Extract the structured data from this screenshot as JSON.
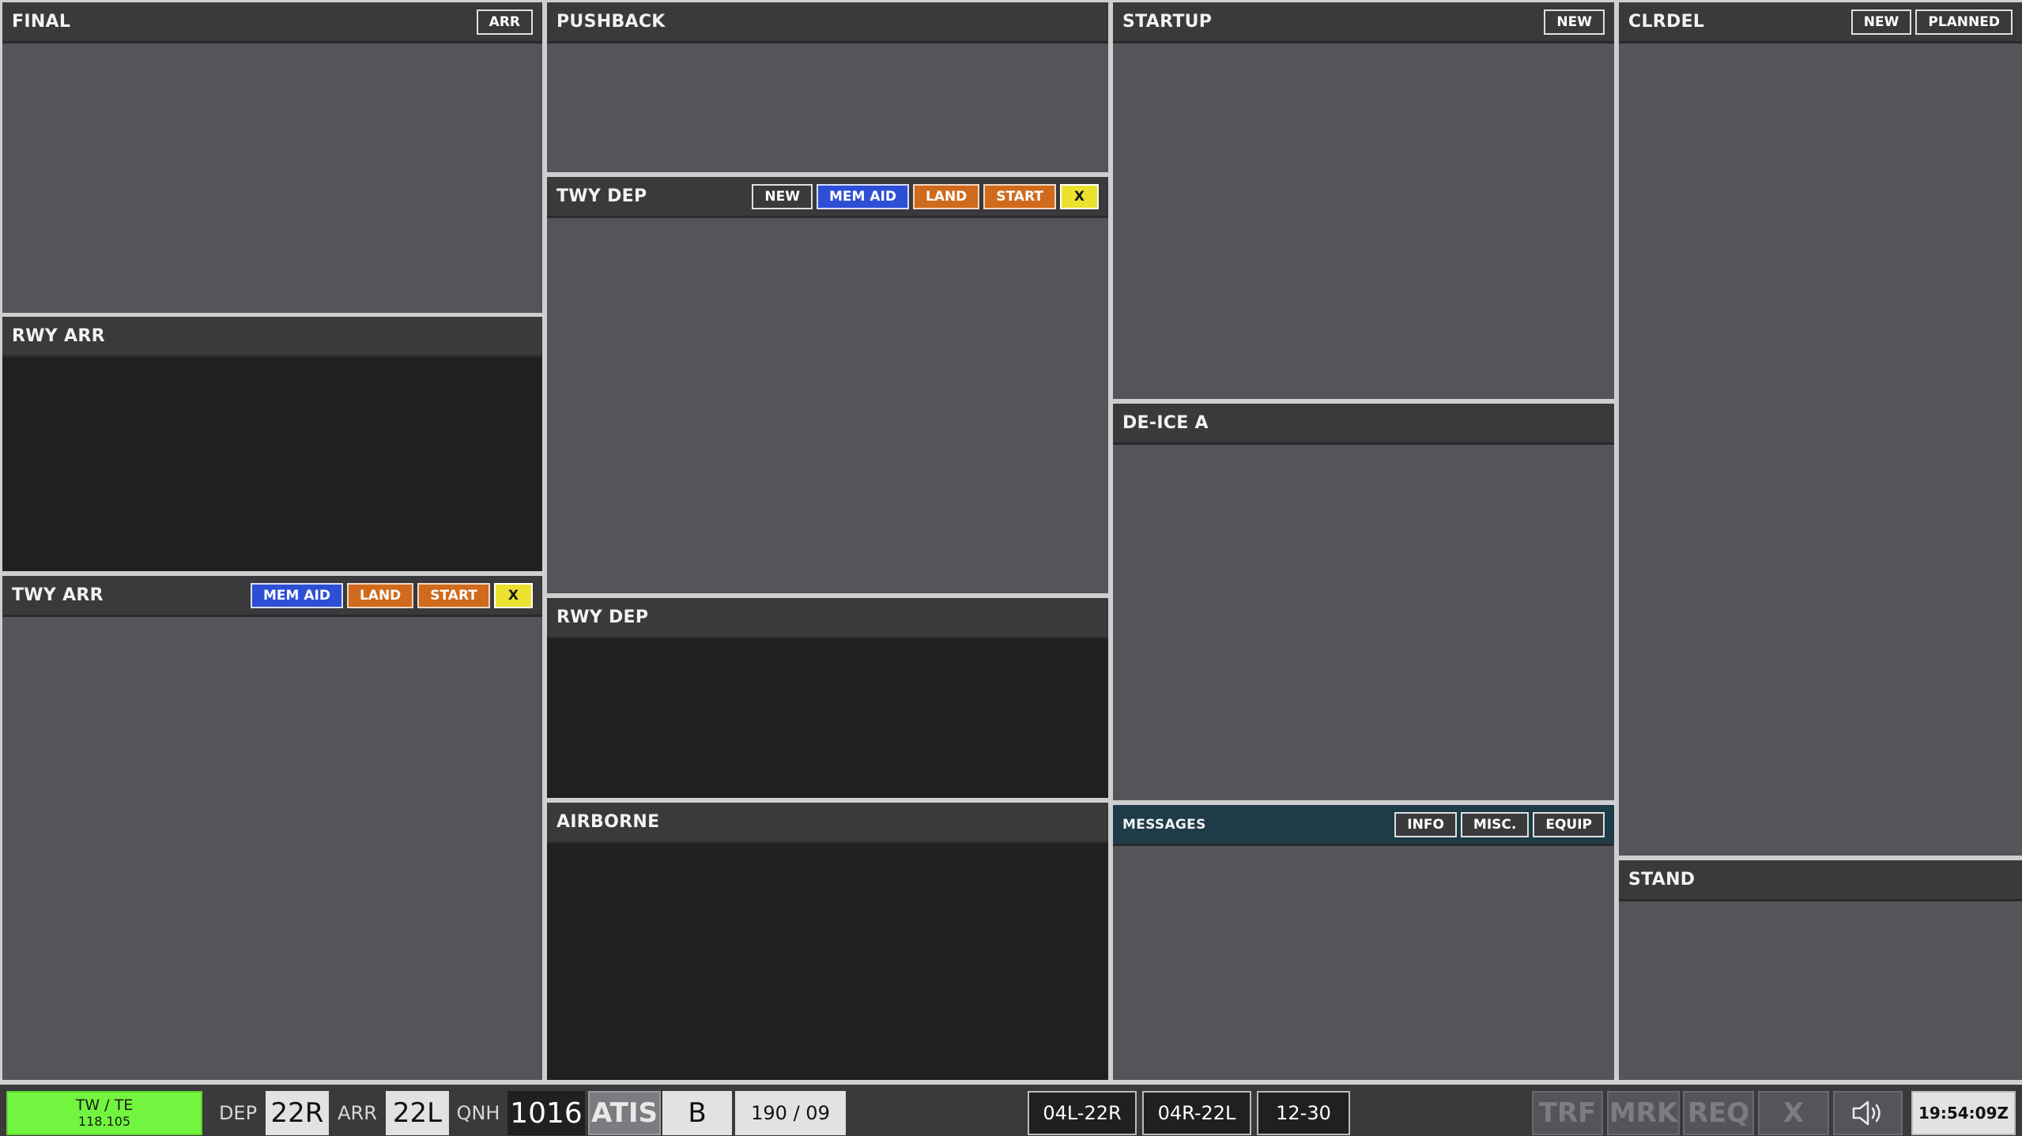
{
  "panels": {
    "final": {
      "title": "FINAL",
      "buttons": [
        "ARR"
      ]
    },
    "rwy_arr": {
      "title": "RWY ARR"
    },
    "twy_arr": {
      "title": "TWY ARR",
      "buttons": [
        "MEM AID",
        "LAND",
        "START",
        "X"
      ]
    },
    "pushback": {
      "title": "PUSHBACK"
    },
    "twy_dep": {
      "title": "TWY DEP",
      "buttons": [
        "NEW",
        "MEM AID",
        "LAND",
        "START",
        "X"
      ]
    },
    "rwy_dep": {
      "title": "RWY DEP"
    },
    "airborne": {
      "title": "AIRBORNE"
    },
    "startup": {
      "title": "STARTUP",
      "buttons": [
        "NEW"
      ]
    },
    "deice": {
      "title": "DE-ICE A"
    },
    "messages": {
      "title": "MESSAGES",
      "buttons": [
        "INFO",
        "MISC.",
        "EQUIP"
      ]
    },
    "clrdel": {
      "title": "CLRDEL",
      "buttons": [
        "NEW",
        "PLANNED"
      ]
    },
    "stand": {
      "title": "STAND"
    }
  },
  "status_bar": {
    "position": "TW / TE",
    "frequency": "118.105",
    "dep_label": "DEP",
    "dep_runway": "22R",
    "arr_label": "ARR",
    "arr_runway": "22L",
    "qnh_label": "QNH",
    "qnh_value": "1016",
    "atis_label": "ATIS",
    "atis_value": "B",
    "wind": "190 / 09",
    "runways": [
      "04L-22R",
      "04R-22L",
      "12-30"
    ],
    "tools": [
      "TRF",
      "MRK",
      "REQ",
      "X"
    ],
    "speaker_icon": "speaker-icon",
    "clock": "19:54:09Z"
  },
  "colors": {
    "panel_bg": "#555458",
    "header_bg": "#3a393c",
    "black_body": "#202020",
    "mem_aid": "#2d4fd6",
    "land_start": "#d06a1c",
    "close": "#ece12e",
    "position_active": "#72f53e",
    "messages_header": "#1e3c48"
  }
}
